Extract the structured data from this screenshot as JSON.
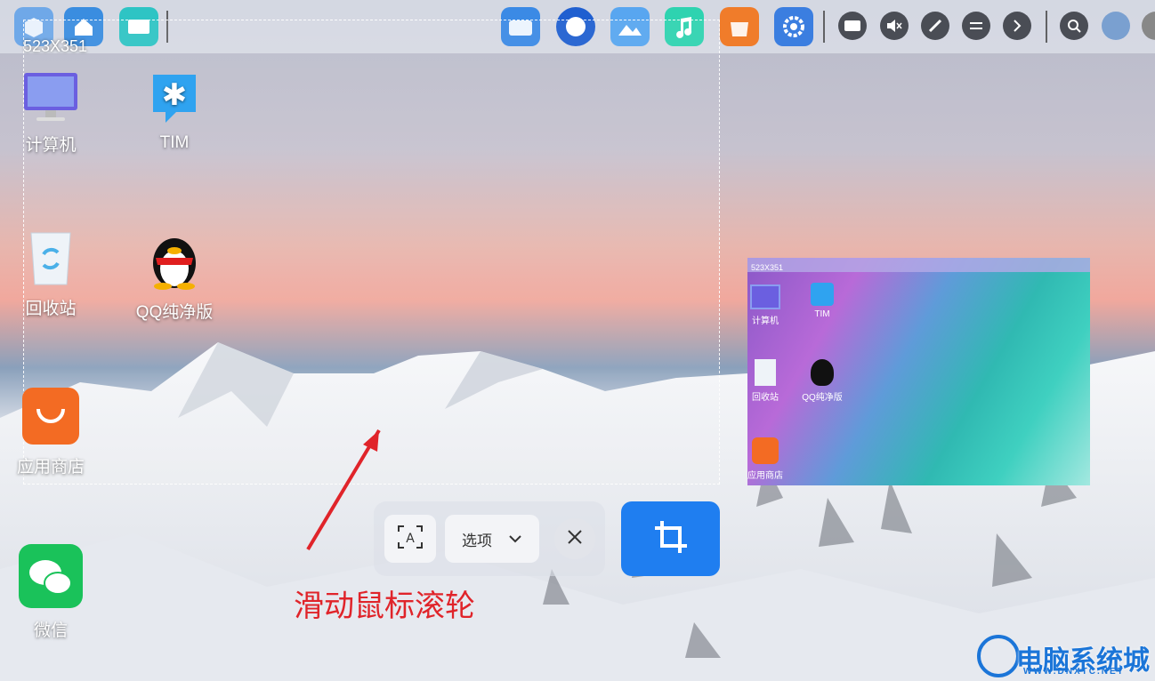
{
  "selection": {
    "size_label": "523X351"
  },
  "desktop": {
    "items": [
      {
        "label": "计算机"
      },
      {
        "label": "TIM"
      },
      {
        "label": "回收站"
      },
      {
        "label": "QQ纯净版"
      },
      {
        "label": "应用商店"
      },
      {
        "label": "微信"
      }
    ]
  },
  "toolbar": {
    "ocr_icon": "ocr-text-icon",
    "options_label": "选项",
    "close_icon": "close-icon",
    "crop_icon": "crop-icon"
  },
  "annotation": {
    "text": "滑动鼠标滚轮"
  },
  "preview": {
    "size_label": "523X351",
    "items": [
      {
        "label": "计算机"
      },
      {
        "label": "TIM"
      },
      {
        "label": "回收站"
      },
      {
        "label": "QQ纯净版"
      },
      {
        "label": "应用商店"
      }
    ]
  },
  "watermark": {
    "text": "电脑系统城",
    "subtext": "WWW.DNXTC.NET"
  },
  "colors": {
    "accent": "#1f7ef0",
    "annotation": "#e0242a"
  }
}
